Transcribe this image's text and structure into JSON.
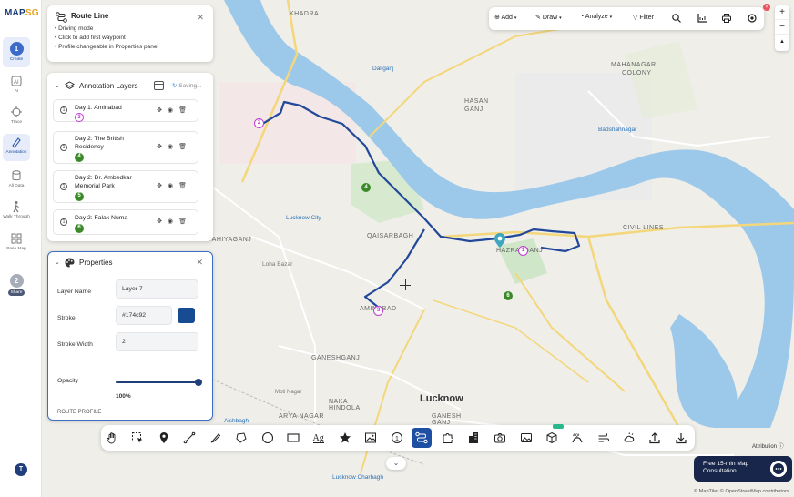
{
  "app": {
    "logo_main": "MAP",
    "logo_accent": "SG"
  },
  "rail": {
    "items": [
      {
        "label": "Create",
        "num": "1"
      },
      {
        "label": "AI"
      },
      {
        "label": "Trace"
      },
      {
        "label": "Annotation"
      },
      {
        "label": "All Data"
      },
      {
        "label": "Walk Through"
      },
      {
        "label": "Base Map"
      },
      {
        "label": "Share",
        "num": "2"
      }
    ],
    "avatar": "T"
  },
  "route_panel": {
    "title": "Route Line",
    "lines": [
      "• Driving mode",
      "• Click to add first waypoint",
      "• Profile changeable in Properties panel"
    ]
  },
  "layers_panel": {
    "title": "Annotation Layers",
    "status": "Saving...",
    "layers": [
      {
        "name": "Day 1: Aminabad",
        "radio": "1",
        "badge": "3",
        "badge_style": "purple"
      },
      {
        "name": "Day 2: The British Residency",
        "radio": "1",
        "badge": "4",
        "badge_style": "green"
      },
      {
        "name": "Day 2: Dr. Ambedkar Memorial Park",
        "radio": "1",
        "badge": "5",
        "badge_style": "green"
      },
      {
        "name": "Day 2: Falak Numa",
        "radio": "1",
        "badge": "6",
        "badge_style": "green"
      }
    ]
  },
  "properties": {
    "title": "Properties",
    "layer_name_label": "Layer Name",
    "layer_name_value": "Layer 7",
    "stroke_label": "Stroke",
    "stroke_value": "#174c92",
    "stroke_color": "#174c92",
    "stroke_width_label": "Stroke Width",
    "stroke_width_value": "2",
    "opacity_label": "Opacity",
    "opacity_value": "100%",
    "opacity_fraction": 1.0,
    "route_profile_label": "ROUTE PROFILE"
  },
  "top_toolbar": {
    "add": "Add",
    "draw": "Draw",
    "analyze": "Analyze",
    "filter": "Filter"
  },
  "zoom": {
    "in": "+",
    "out": "−",
    "north": "▲"
  },
  "map_labels": {
    "khadra": "KHADRA",
    "daliganj": "Daliganj",
    "mahanagar": "MAHANAGAR",
    "colony": "COLONY",
    "hasan": "HASAN",
    "ganj": "GANJ",
    "badshahnagar": "Badshahnagar",
    "lucknow_city": "Lucknow City",
    "yahiyaganj": "YAHIYAGANJ",
    "qaisarbagh": "QAISARBAGH",
    "hazratganj": "HAZRATGANJ",
    "civil_lines": "CIVIL LINES",
    "loha_bazar": "Loha Bazar",
    "aminabad": "AMINABAD",
    "ganeshganj": "GANESHGANJ",
    "moti_nagar": "Moti Nagar",
    "naka_hindola": "NAKA\nHINDOLA",
    "lucknow": "Lucknow",
    "aishbagh": "Aishbagh",
    "arya_nagar": "ARYA NAGAR",
    "ganesh_ganj": "GANESH\nGANJ",
    "lucknow_charbagh": "Lucknow Charbagh"
  },
  "consult": {
    "line1": "Free 15-min Map",
    "line2": "Consultation"
  },
  "attribution": "Attribution",
  "credits": "© MapTiler © OpenStreetMap contributors"
}
